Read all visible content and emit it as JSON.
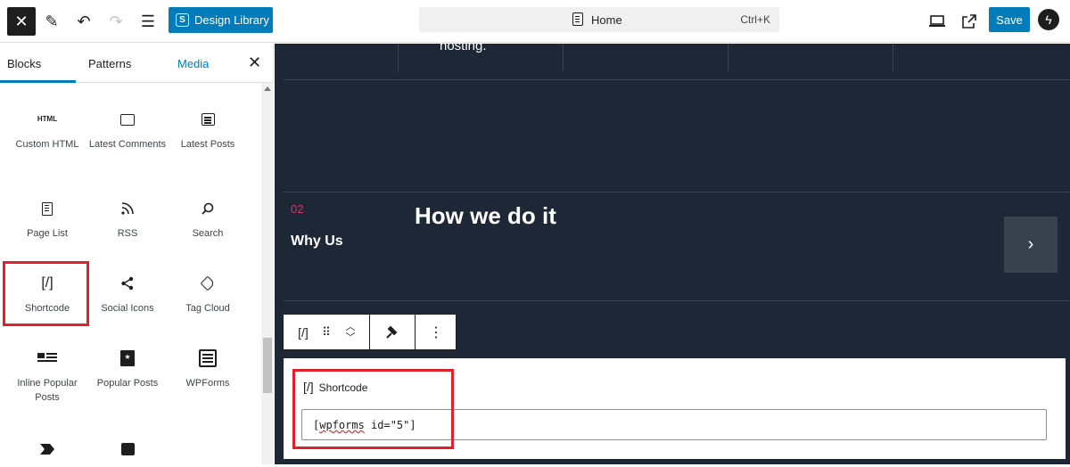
{
  "topbar": {
    "design_library": "Design Library",
    "command": "Home",
    "shortcut": "Ctrl+K",
    "save": "Save"
  },
  "sidebar": {
    "tabs": [
      "Blocks",
      "Patterns",
      "Media"
    ],
    "blocks": [
      {
        "label": "Custom HTML",
        "icon_text": "HTML"
      },
      {
        "label": "Latest Comments"
      },
      {
        "label": "Latest Posts"
      },
      {
        "label": "Page List"
      },
      {
        "label": "RSS"
      },
      {
        "label": "Search"
      },
      {
        "label": "Shortcode",
        "icon_text": "[/]"
      },
      {
        "label": "Social Icons"
      },
      {
        "label": "Tag Cloud"
      },
      {
        "label": "Inline Popular Posts"
      },
      {
        "label": "Popular Posts"
      },
      {
        "label": "WPForms"
      }
    ]
  },
  "canvas": {
    "hosting_text": "hosting.",
    "number": "02",
    "why_us": "Why Us",
    "heading": "How we do it"
  },
  "toolbar": {
    "block_icon": "[/]"
  },
  "shortcode_block": {
    "icon": "[/]",
    "title": "Shortcode",
    "value_prefix": "[",
    "value_word": "wpforms",
    "value_suffix": " id=\"5\"]"
  },
  "colors": {
    "accent": "#007cba",
    "highlight": "#e0202a",
    "canvas_bg": "#1d2736",
    "number_pink": "#d6336c"
  }
}
